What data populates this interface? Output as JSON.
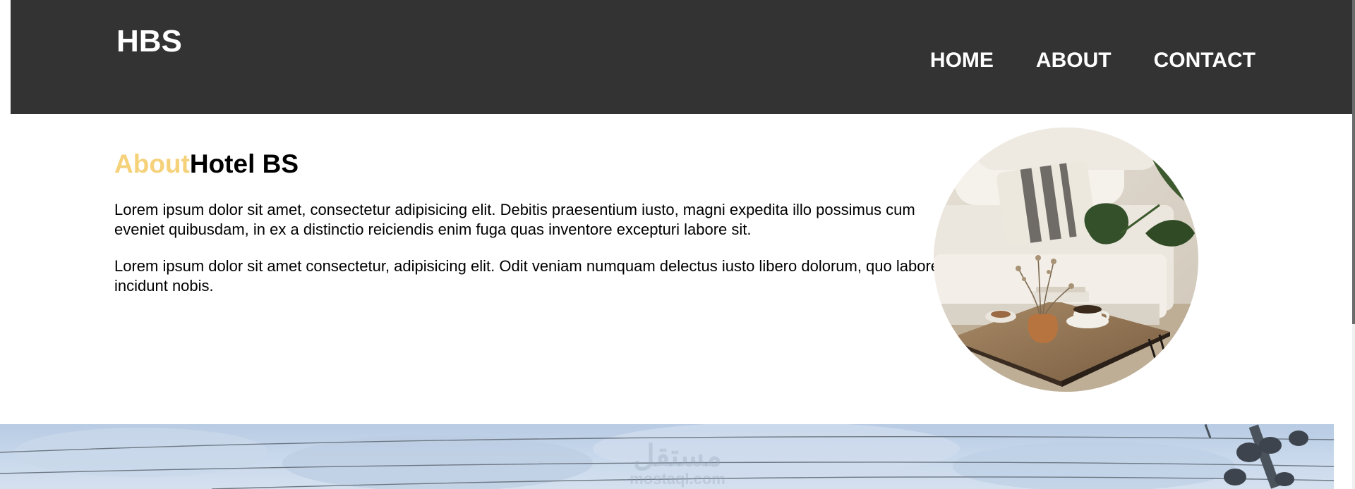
{
  "header": {
    "logo": "HBS",
    "nav": [
      {
        "label": "HOME"
      },
      {
        "label": "ABOUT"
      },
      {
        "label": "CONTACT"
      }
    ]
  },
  "about": {
    "title_accent": "About",
    "title_main": "Hotel BS",
    "paragraphs": [
      "Lorem ipsum dolor sit amet, consectetur adipisicing elit. Debitis praesentium iusto, magni expedita illo possimus cum eveniet quibusdam, in ex a distinctio reiciendis enim fuga quas inventore excepturi labore sit.",
      "Lorem ipsum dolor sit amet consectetur, adipisicing elit. Odit veniam numquam delectus iusto libero dolorum, quo labore incidunt nobis."
    ]
  },
  "watermark": {
    "arabic": "مستقل",
    "site": "mostaql.com"
  },
  "colors": {
    "header_bg": "#333333",
    "accent": "#f5d17a",
    "text": "#000000",
    "nav_text": "#ffffff"
  }
}
